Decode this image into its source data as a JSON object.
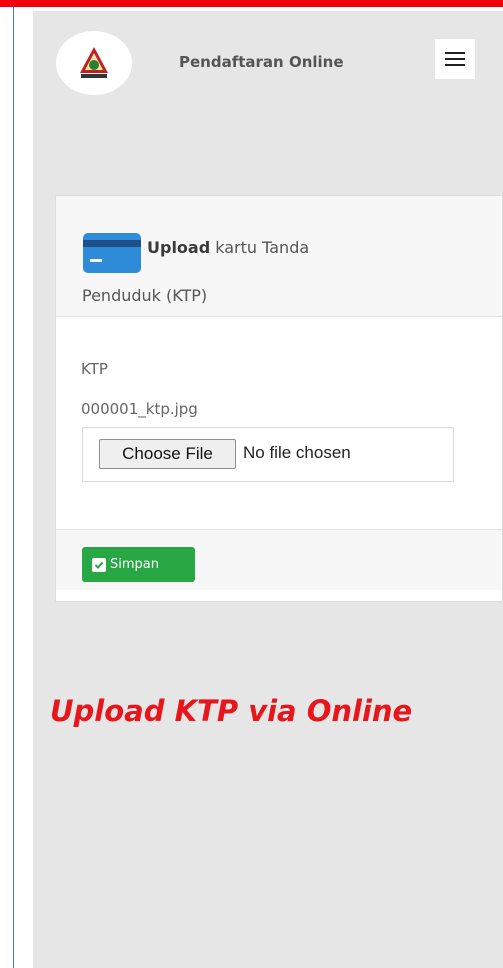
{
  "navbar": {
    "brand": "Pendaftaran Online",
    "logo_icon": "emblem-icon",
    "menu_icon": "hamburger-icon"
  },
  "card": {
    "icon": "id-card-icon",
    "title_bold": "Upload",
    "title_rest": " kartu Tanda",
    "title_line2": "Penduduk (KTP)",
    "field_label": "KTP",
    "current_file": "000001_ktp.jpg",
    "file_input": {
      "button_label": "Choose File",
      "status": "No file chosen"
    },
    "save_label": "Simpan"
  },
  "caption": "Upload KTP via Online",
  "colors": {
    "accent_red": "#f2020a",
    "save_green": "#28a745",
    "card_icon_blue": "#2e8bd8"
  }
}
